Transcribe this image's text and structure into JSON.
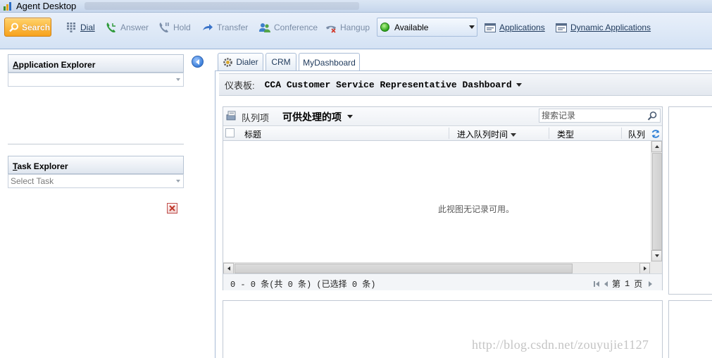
{
  "window": {
    "title": "Agent Desktop"
  },
  "toolbar": {
    "search_label": "Search",
    "dial_label": "Dial",
    "answer_label": "Answer",
    "hold_label": "Hold",
    "transfer_label": "Transfer",
    "conference_label": "Conference",
    "hangup_label": "Hangup",
    "status_value": "Available",
    "applications_label": "Applications",
    "dynamic_applications_label": "Dynamic Applications"
  },
  "left_panel": {
    "application_explorer": {
      "title_prefix": "A",
      "title_rest": "pplication Explorer",
      "combo_value": ""
    },
    "task_explorer": {
      "title_prefix": "T",
      "title_rest": "ask Explorer",
      "combo_placeholder": "Select Task"
    }
  },
  "tabs": [
    "Dialer",
    "CRM",
    "MyDashboard"
  ],
  "dashboard": {
    "label": "仪表板:",
    "name": "CCA Customer Service Representative Dashboard"
  },
  "queue_grid": {
    "queue_label": "队列项",
    "view_name": "可供处理的项",
    "search_placeholder": "搜索记录",
    "columns": [
      "标题",
      "进入队列时间",
      "类型",
      "队列"
    ],
    "empty_message": "此视图无记录可用。",
    "record_count": "0 - 0  条(共 0 条) (已选择 0 条)",
    "page_label_prefix": "第",
    "page_number": "1",
    "page_label_suffix": "页"
  },
  "watermark": "http://blog.csdn.net/zouyujie1127",
  "colors": {
    "accent": "#f7a21c",
    "status_available": "#2ca31a",
    "toolbar_bg": "#d4e2f4"
  }
}
